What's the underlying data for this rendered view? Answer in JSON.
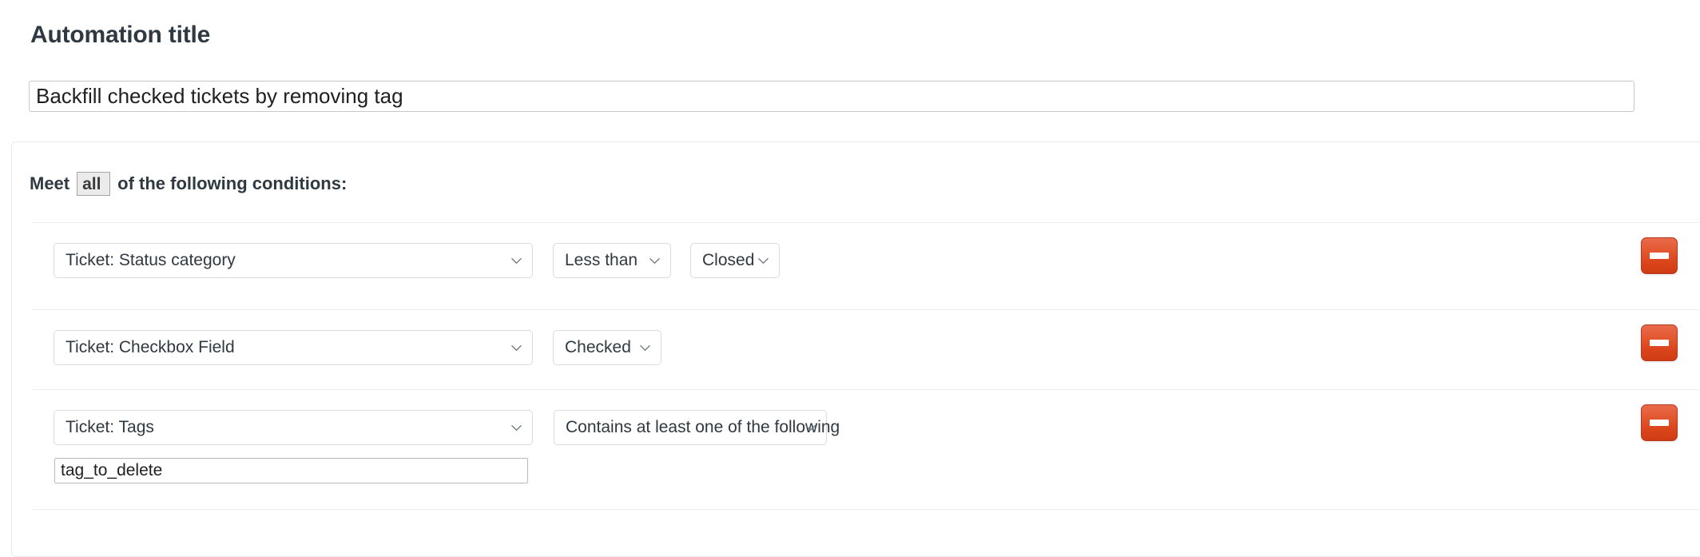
{
  "form": {
    "title_label": "Automation title",
    "title_value": "Backfill checked tickets by removing tag",
    "title_placeholder": "Automation title"
  },
  "conditions": {
    "meet_prefix": "Meet",
    "match_type": "all",
    "meet_suffix": "of the following conditions:",
    "remove_icon": "minus-icon",
    "chevron_icon": "chevron-down-icon",
    "rows": [
      {
        "field": "Ticket: Status category",
        "operator": "Less than",
        "value": "Closed",
        "text_value": null,
        "remove_label": "Remove condition"
      },
      {
        "field": "Ticket: Checkbox Field",
        "operator": "Checked",
        "value": null,
        "text_value": null,
        "remove_label": "Remove condition"
      },
      {
        "field": "Ticket: Tags",
        "operator": "Contains at least one of the following",
        "value": null,
        "text_value": "tag_to_delete",
        "remove_label": "Remove condition"
      }
    ]
  },
  "colors": {
    "text": "#2f3941",
    "border": "#d8dcde",
    "card_border": "#e9ebed",
    "separator": "#ebedee",
    "danger": "#d9441a",
    "match_chip_bg": "#ebebeb"
  }
}
